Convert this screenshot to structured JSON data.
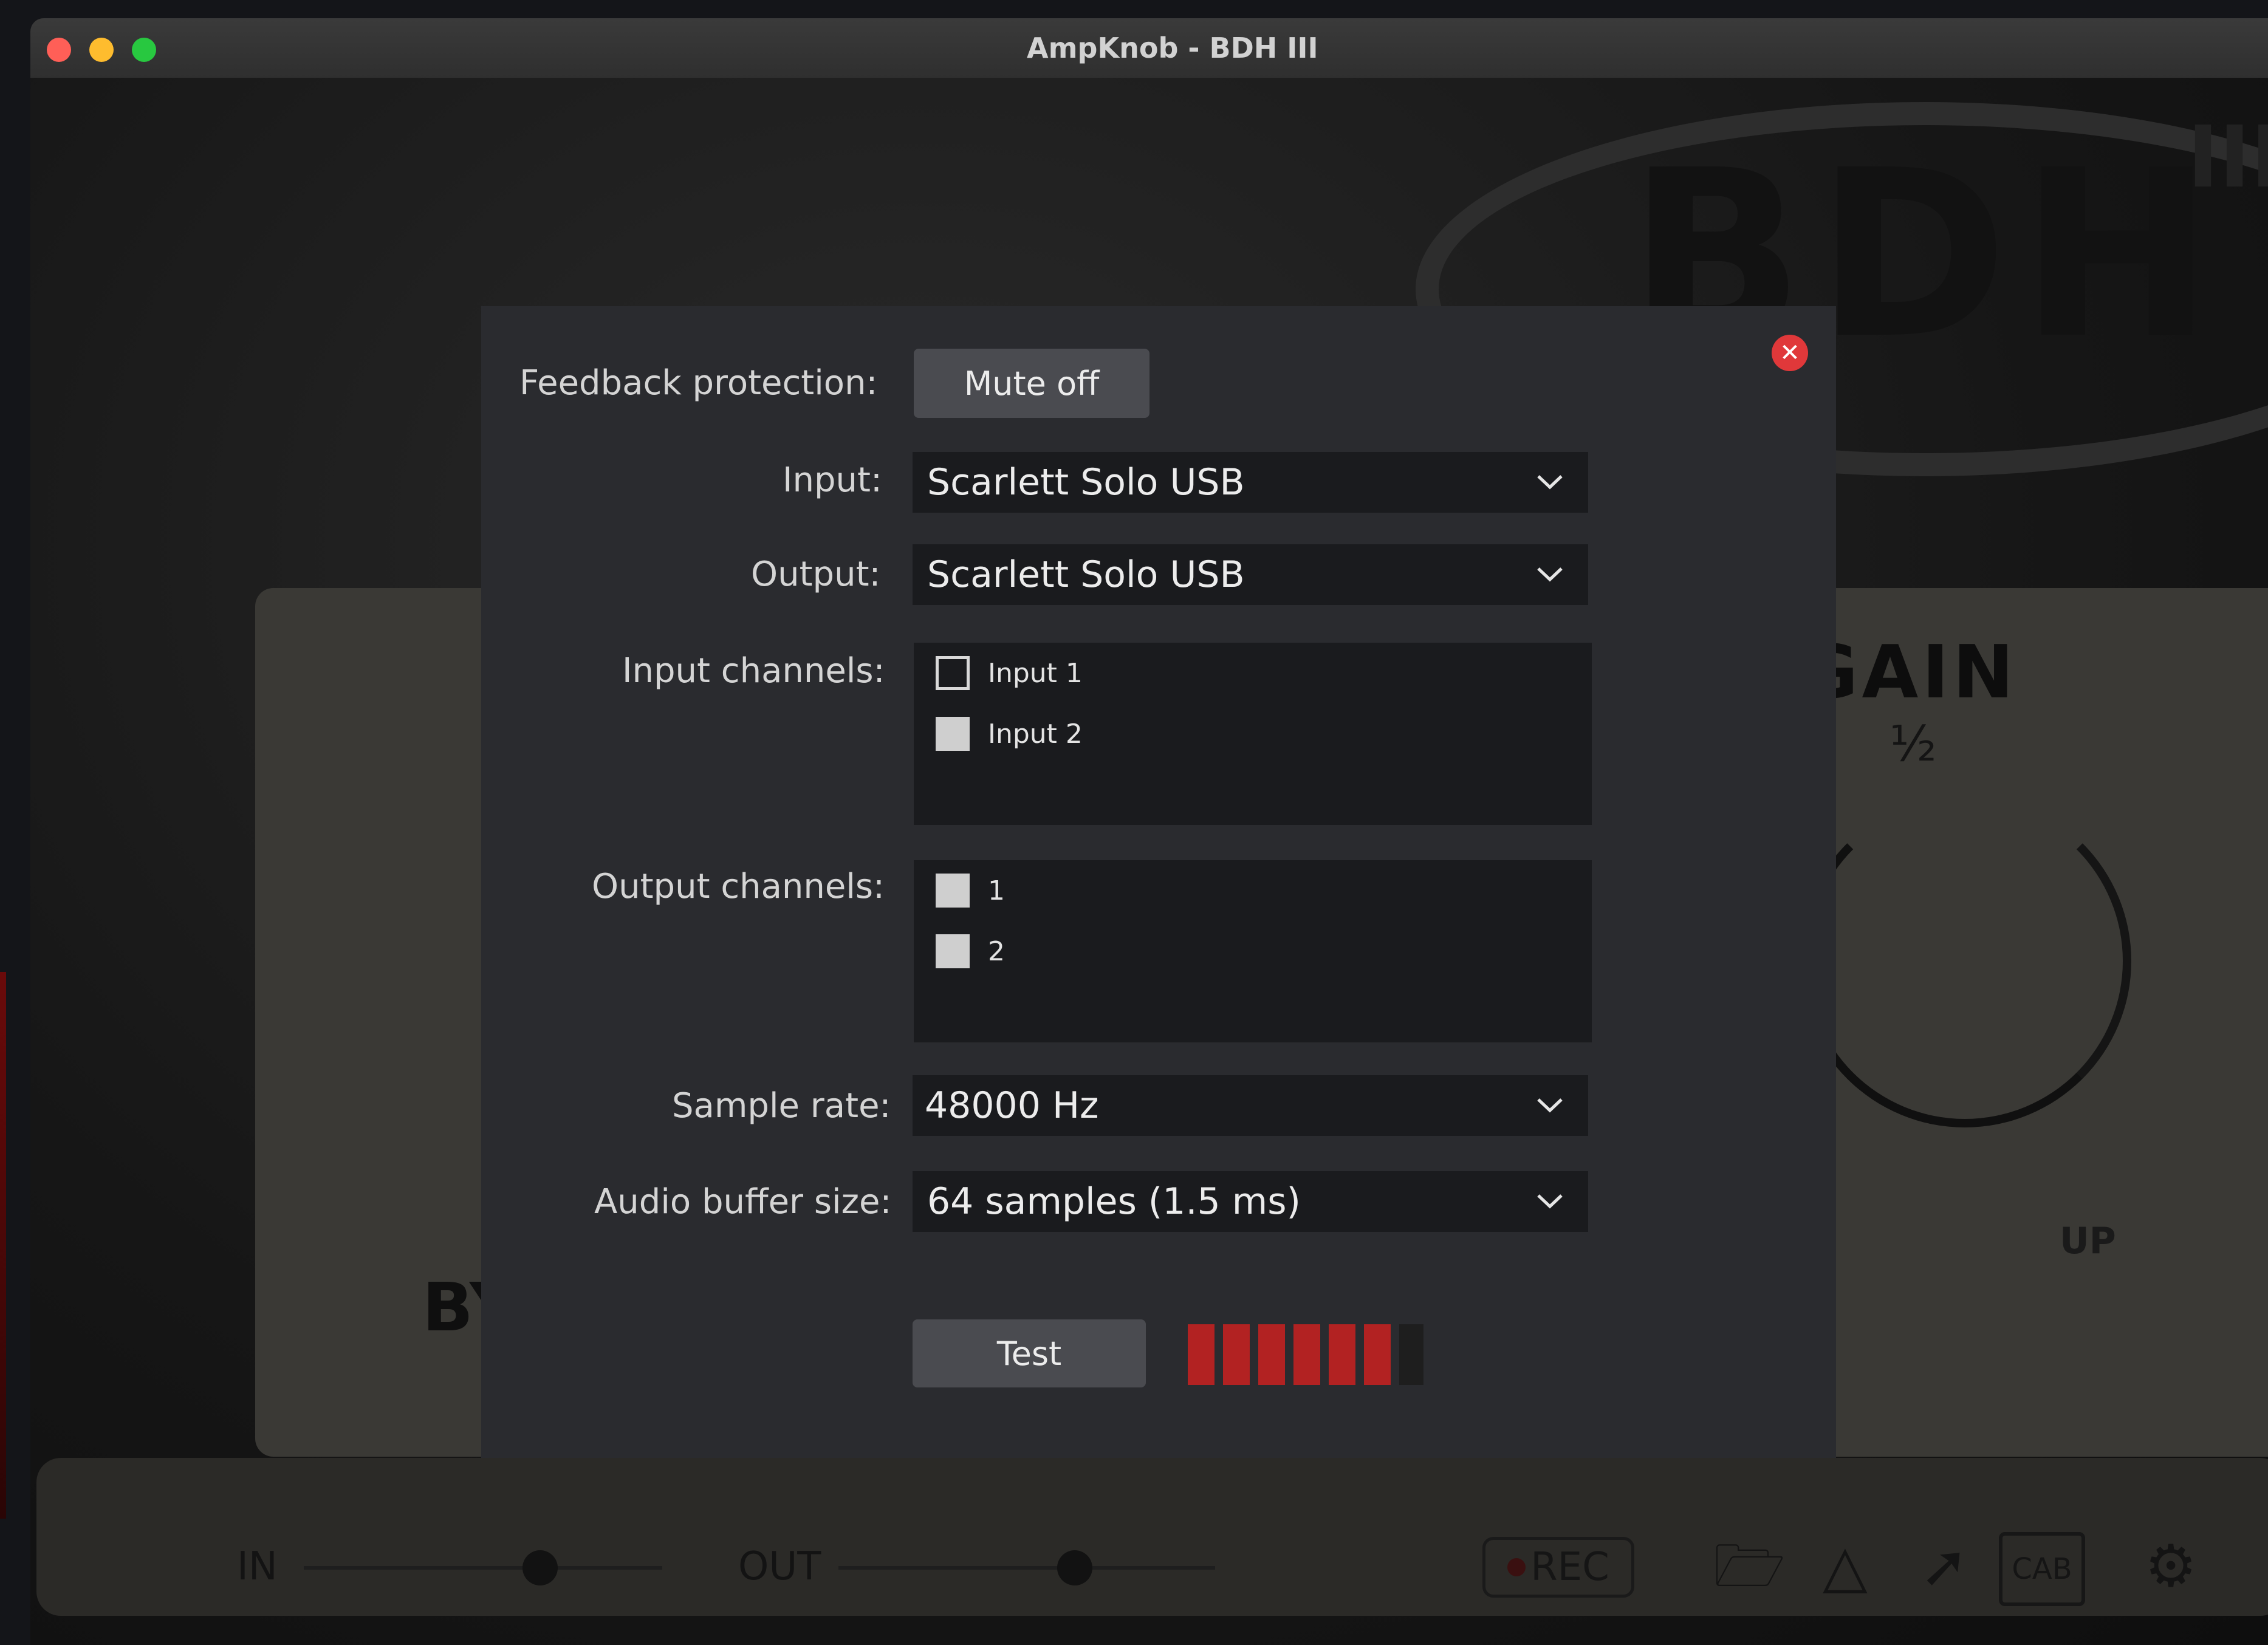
{
  "window": {
    "title": "AmpKnob - BDH III"
  },
  "amp": {
    "logo": "BDH",
    "logo_sup": "III",
    "gain_label": "GAIN",
    "gain_marker": "½",
    "gain_up": "UP",
    "by_text": "BY",
    "footer": {
      "in_label": "IN",
      "out_label": "OUT",
      "rec_label": "REC",
      "cab_label": "CAB"
    }
  },
  "dialog": {
    "feedback": {
      "label": "Feedback protection:",
      "button": "Mute off"
    },
    "input": {
      "label": "Input:",
      "value": "Scarlett Solo USB"
    },
    "output": {
      "label": "Output:",
      "value": "Scarlett Solo USB"
    },
    "input_channels": {
      "label": "Input channels:",
      "items": [
        {
          "label": "Input 1",
          "checked": false
        },
        {
          "label": "Input 2",
          "checked": true
        }
      ]
    },
    "output_channels": {
      "label": "Output channels:",
      "items": [
        {
          "label": "1",
          "checked": true
        },
        {
          "label": "2",
          "checked": true
        }
      ]
    },
    "sample_rate": {
      "label": "Sample rate:",
      "value": "48000 Hz"
    },
    "buffer_size": {
      "label": "Audio buffer size:",
      "value": "64 samples (1.5 ms)"
    },
    "test": {
      "button": "Test",
      "meter_segments_total": 7,
      "meter_segments_lit": 6
    },
    "colors": {
      "meter_lit": "#b22222",
      "close": "#e0383a"
    }
  }
}
